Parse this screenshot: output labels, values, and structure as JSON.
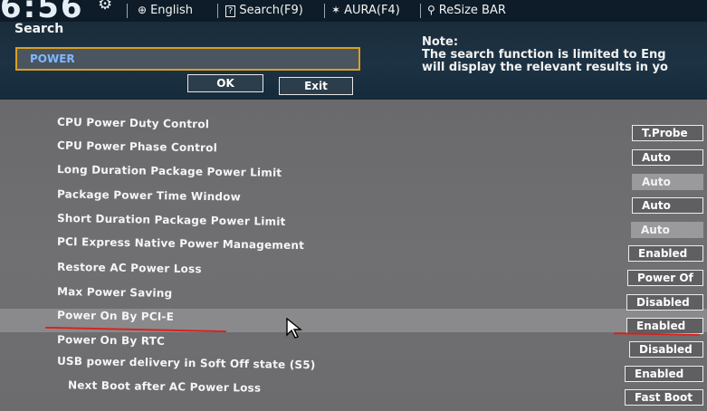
{
  "topbar": {
    "clock": "6:56",
    "language": "English",
    "search_label": "Search(F9)",
    "aura_label": "AURA(F4)",
    "resize_bar_label": "ReSize BAR"
  },
  "search": {
    "label": "Search",
    "value": "POWER",
    "ok_label": "OK",
    "exit_label": "Exit",
    "note_title": "Note:",
    "note_line1": "The search function is limited to Eng",
    "note_line2": "will display the relevant results in yo"
  },
  "settings": [
    {
      "label": "CPU Power Duty Control",
      "value": "T.Probe",
      "enabled": true
    },
    {
      "label": "CPU Power Phase Control",
      "value": "Auto",
      "enabled": true
    },
    {
      "label": "Long Duration Package Power Limit",
      "value": "Auto",
      "enabled": false
    },
    {
      "label": "Package Power Time Window",
      "value": "Auto",
      "enabled": true
    },
    {
      "label": "Short Duration Package Power Limit",
      "value": "Auto",
      "enabled": false
    },
    {
      "label": "PCI Express Native Power Management",
      "value": "Enabled",
      "enabled": true
    },
    {
      "label": "Restore AC Power Loss",
      "value": "Power Of",
      "enabled": true
    },
    {
      "label": "Max Power Saving",
      "value": "Disabled",
      "enabled": true
    },
    {
      "label": "Power On By PCI-E",
      "value": "Enabled",
      "enabled": true,
      "selected": true
    },
    {
      "label": "Power On By RTC",
      "value": "Disabled",
      "enabled": true
    },
    {
      "label": "USB power delivery in Soft Off state (S5)",
      "value": "Enabled",
      "enabled": true
    },
    {
      "label": "Next Boot after AC Power Loss",
      "value": "Fast Boot",
      "enabled": true
    }
  ],
  "colors": {
    "accent_border": "#d8a020",
    "annotation_red": "#d8221f",
    "panel_dark": "#1d3344",
    "settings_bg": "#6e6e70"
  },
  "icons": [
    "globe-icon",
    "search-key-icon",
    "aura-icon",
    "resize-bar-icon",
    "gear-icon",
    "mouse-pointer-icon"
  ]
}
